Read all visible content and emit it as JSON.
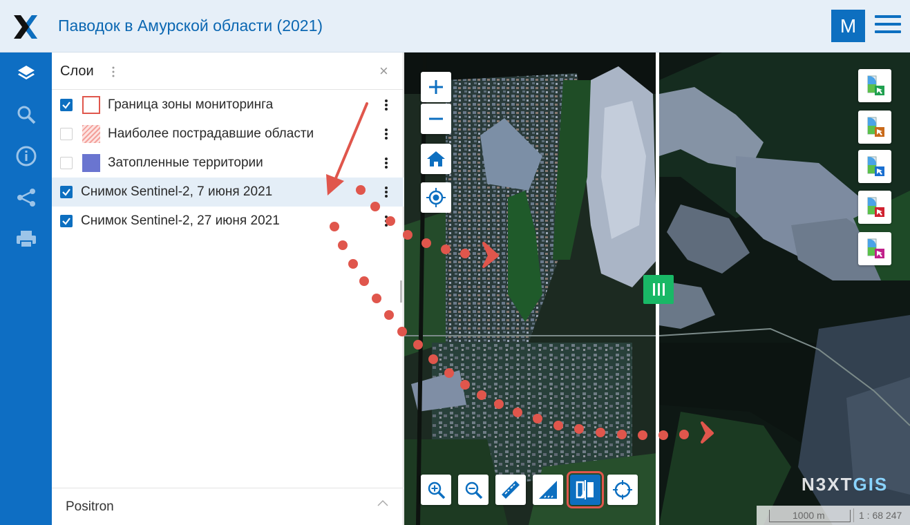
{
  "header": {
    "title": "Паводок в Амурской области (2021)",
    "user_initial": "M"
  },
  "nav": {
    "items": [
      "layers-icon",
      "search-icon",
      "info-icon",
      "share-icon",
      "print-icon"
    ]
  },
  "panel": {
    "title": "Слои",
    "close": "×",
    "layers": [
      {
        "label": "Граница зоны мониторинга",
        "checked": true,
        "legend": "outline-red"
      },
      {
        "label": "Наиболее пострадавшие области",
        "checked": false,
        "legend": "hatched-red"
      },
      {
        "label": "Затопленные территории",
        "checked": false,
        "legend": "fill-blue"
      },
      {
        "label": "Снимок Sentinel-2, 7 июня 2021",
        "checked": true,
        "selected": true
      },
      {
        "label": "Снимок Sentinel-2, 27 июня 2021",
        "checked": true
      }
    ],
    "basemap": "Positron"
  },
  "map": {
    "watermark_a": "N3XT",
    "watermark_b": "GIS",
    "scale_text": "1000 m",
    "scale_ratio": "1 : 68 247",
    "colors": {
      "accent": "#0d6fc0",
      "swipe": "#19b866",
      "annotation": "#e0564c"
    }
  }
}
